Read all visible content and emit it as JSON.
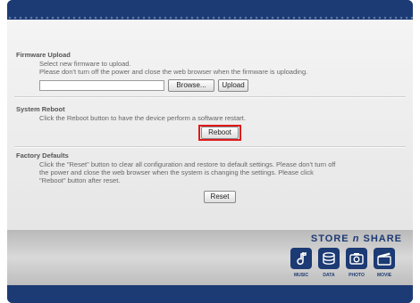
{
  "firmware": {
    "title": "Firmware Upload",
    "line1": "Select new firmware to upload.",
    "line2": "Please don't turn off the power and close the web browser when the firmware is uploading.",
    "file_value": "",
    "browse_label": "Browse...",
    "upload_label": "Upload"
  },
  "reboot": {
    "title": "System Reboot",
    "desc": "Click the Reboot button to have the device perform a software restart.",
    "button_label": "Reboot"
  },
  "factory": {
    "title": "Factory Defaults",
    "line1": "Click the \"Reset\" button to clear all configuration and restore to default settings. Please don't turn off",
    "line2": "the power and close the web browser when the system is changing the settings. Please click",
    "line3": "\"Reboot\" button after reset.",
    "button_label": "Reset"
  },
  "brand": {
    "part1": "STORE",
    "part2": "n",
    "part3": "SHARE",
    "icons": [
      {
        "name": "music-icon",
        "label": "MUSIC",
        "glyph": "♪"
      },
      {
        "name": "data-icon",
        "label": "DATA",
        "glyph": "▤"
      },
      {
        "name": "photo-icon",
        "label": "PHOTO",
        "glyph": "◉"
      },
      {
        "name": "movie-icon",
        "label": "MOVIE",
        "glyph": "▶"
      }
    ]
  },
  "colors": {
    "frame": "#1c3a73",
    "highlight": "#e0191b"
  }
}
